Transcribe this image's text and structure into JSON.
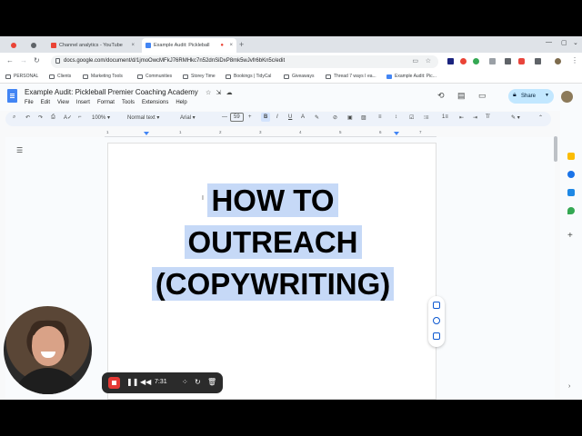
{
  "browser": {
    "tabs": [
      {
        "label": "",
        "favicon_color": "#ea4335"
      },
      {
        "label": "",
        "favicon_color": "#5f6368"
      },
      {
        "label": "Channel analytics - YouTube",
        "favicon_color": "#ea4335"
      },
      {
        "label": "Example Audit: Pickleball",
        "favicon_color": "#4285f4"
      }
    ],
    "new_tab_icon": "plus-icon",
    "url": "docs.google.com/document/d/1jmoOwcMFkJ76RMHkc7n52dnSiDxP8mk5wJvfr6bKn5c/edit",
    "bookmarks": [
      "PERSONAL",
      "Clients",
      "Marketing Tools",
      "Communities",
      "Storey Time",
      "Bookings | TidyCal",
      "Giveaways",
      "Thread 7 ways I ea...",
      "Example Audit: Pic..."
    ]
  },
  "docs": {
    "title": "Example Audit: Pickleball Premier Coaching Academy",
    "menus": [
      "File",
      "Edit",
      "View",
      "Insert",
      "Format",
      "Tools",
      "Extensions",
      "Help"
    ],
    "share_label": "Share",
    "toolbar": {
      "zoom": "100%",
      "style": "Normal text",
      "font": "Arial",
      "font_size": "59"
    },
    "ruler_numbers": [
      "1",
      "1",
      "2",
      "3",
      "4",
      "5",
      "6",
      "7"
    ],
    "heading_lines": [
      "HOW TO",
      "OUTREACH",
      "(COPYWRITING)"
    ],
    "highlight_color": "#c6d9f7",
    "accent_color": "#0b57d0",
    "share_bg": "#c2e7ff"
  },
  "recorder": {
    "time": "7:31",
    "record_color": "#e53935"
  }
}
